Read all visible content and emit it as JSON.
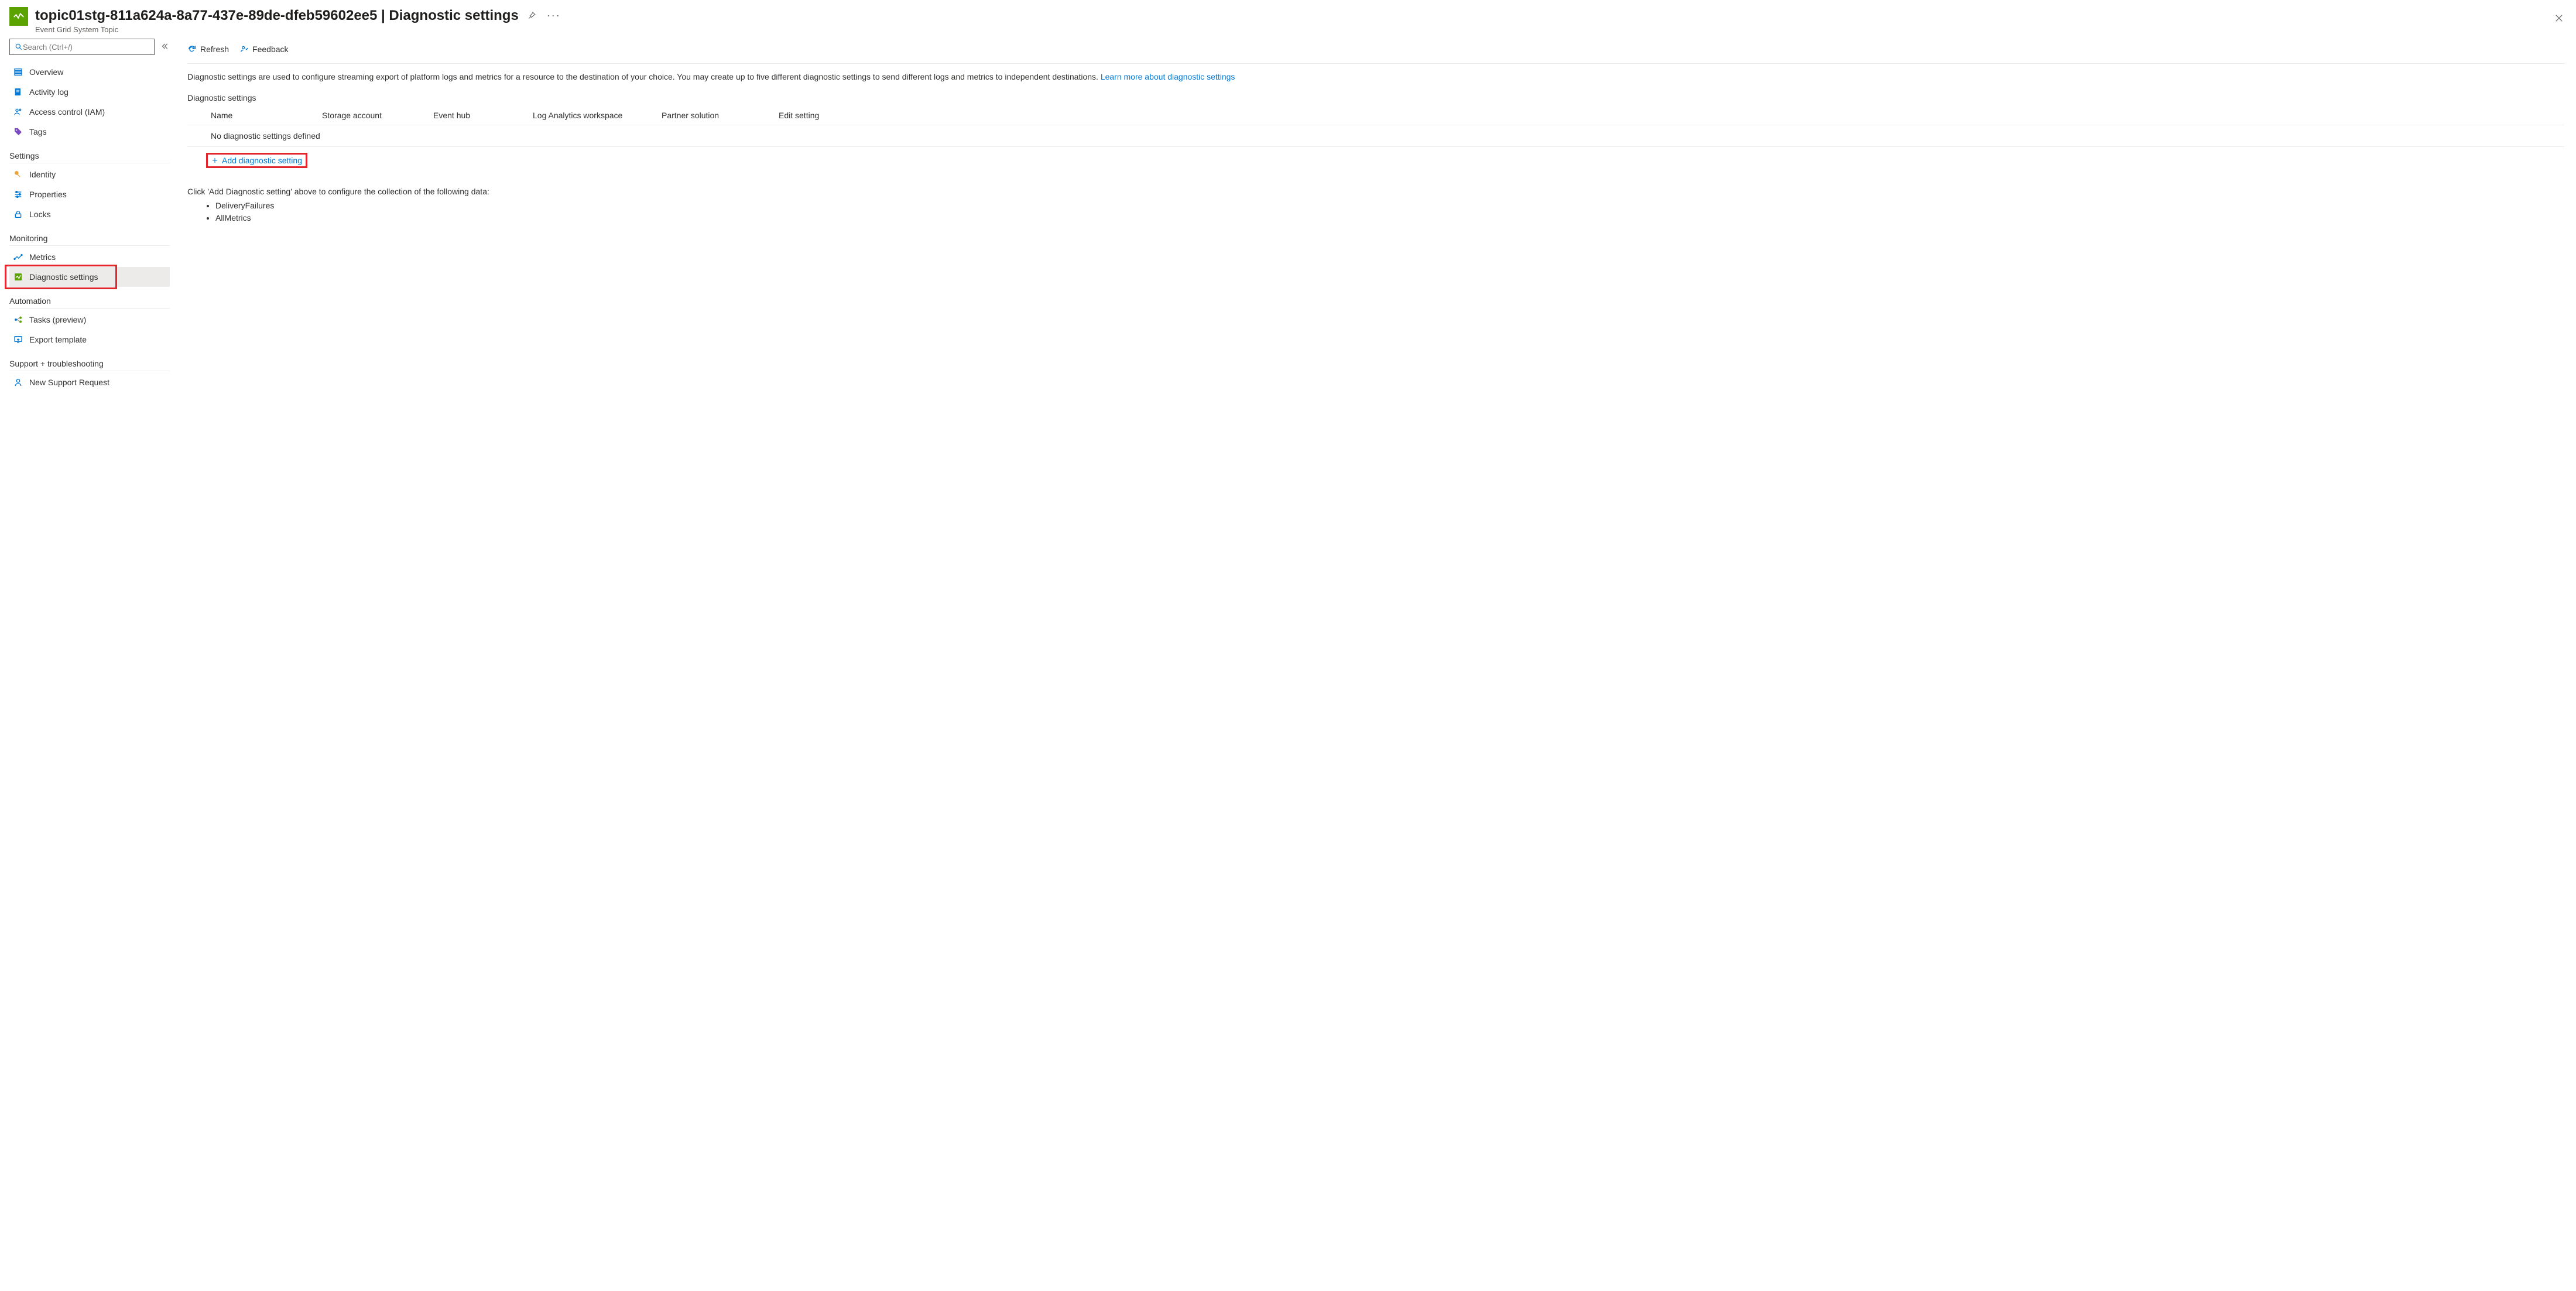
{
  "header": {
    "title": "topic01stg-811a624a-8a77-437e-89de-dfeb59602ee5 | Diagnostic settings",
    "subtitle": "Event Grid System Topic"
  },
  "sidebar": {
    "search_placeholder": "Search (Ctrl+/)",
    "top_items": [
      {
        "label": "Overview"
      },
      {
        "label": "Activity log"
      },
      {
        "label": "Access control (IAM)"
      },
      {
        "label": "Tags"
      }
    ],
    "groups": [
      {
        "title": "Settings",
        "items": [
          {
            "label": "Identity"
          },
          {
            "label": "Properties"
          },
          {
            "label": "Locks"
          }
        ]
      },
      {
        "title": "Monitoring",
        "items": [
          {
            "label": "Metrics"
          },
          {
            "label": "Diagnostic settings",
            "selected": true
          }
        ]
      },
      {
        "title": "Automation",
        "items": [
          {
            "label": "Tasks (preview)"
          },
          {
            "label": "Export template"
          }
        ]
      },
      {
        "title": "Support + troubleshooting",
        "items": [
          {
            "label": "New Support Request"
          }
        ]
      }
    ]
  },
  "toolbar": {
    "refresh": "Refresh",
    "feedback": "Feedback"
  },
  "main": {
    "description_text": "Diagnostic settings are used to configure streaming export of platform logs and metrics for a resource to the destination of your choice. You may create up to five different diagnostic settings to send different logs and metrics to independent destinations. ",
    "learn_more": "Learn more about diagnostic settings",
    "section_label": "Diagnostic settings",
    "columns": {
      "name": "Name",
      "storage": "Storage account",
      "eventhub": "Event hub",
      "log": "Log Analytics workspace",
      "partner": "Partner solution",
      "edit": "Edit setting"
    },
    "empty_text": "No diagnostic settings defined",
    "add_link": "Add diagnostic setting",
    "help_text": "Click 'Add Diagnostic setting' above to configure the collection of the following data:",
    "bullets": [
      "DeliveryFailures",
      "AllMetrics"
    ]
  }
}
